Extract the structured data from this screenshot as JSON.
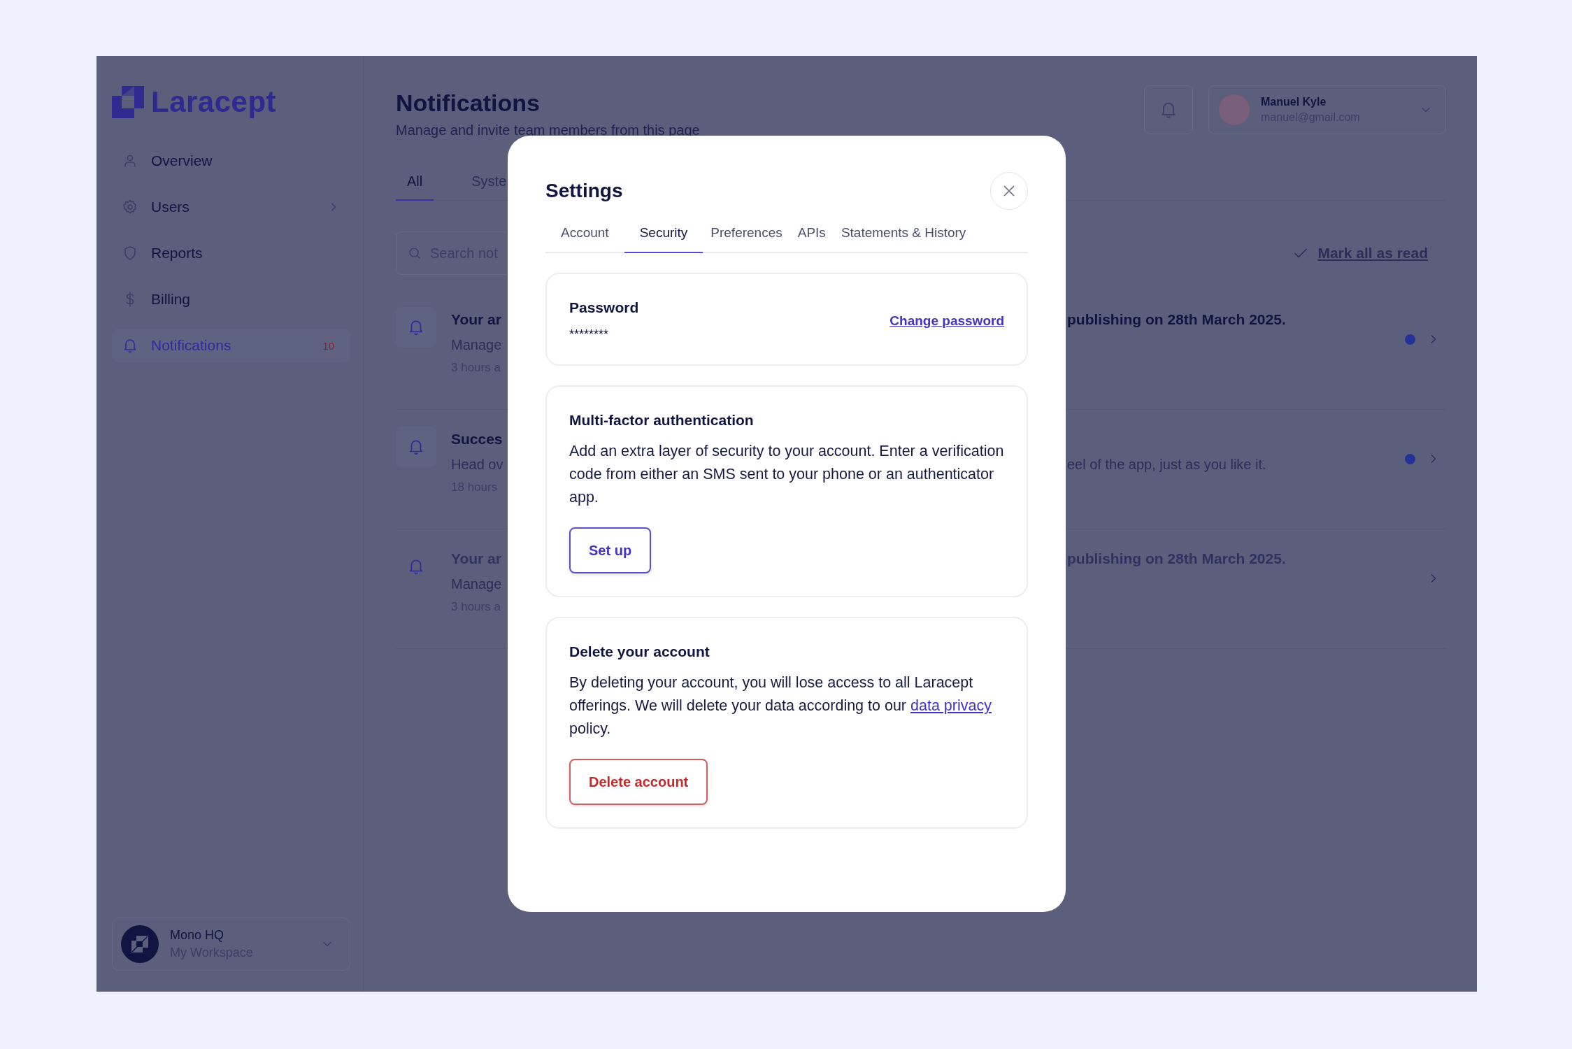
{
  "sidebar": {
    "logo": "Laracept",
    "items": [
      {
        "label": "Overview",
        "expandable": false,
        "selected": false
      },
      {
        "label": "Users",
        "expandable": true,
        "selected": false
      },
      {
        "label": "Reports",
        "expandable": false,
        "selected": false
      },
      {
        "label": "Billing",
        "expandable": false,
        "selected": false
      },
      {
        "label": "Notifications",
        "expandable": false,
        "selected": true,
        "badge": "10"
      }
    ],
    "workspace": {
      "name": "Mono HQ",
      "subtitle": "My Workspace"
    }
  },
  "header": {
    "title": "Notifications",
    "subtitle": "Manage and invite team members from this page",
    "user": {
      "name": "Manuel Kyle",
      "email": "manuel@gmail.com"
    }
  },
  "tabs": [
    {
      "label": "All",
      "selected": true
    },
    {
      "label": "Syste",
      "selected": false
    }
  ],
  "search": {
    "placeholder": "Search not"
  },
  "mark_all": "Mark all as read",
  "notifications": [
    {
      "title": "Your ar",
      "message": "Manage",
      "time": "3 hours a",
      "title_rest": "publishing on 28th March 2025.",
      "unread": true
    },
    {
      "title": "Succes",
      "message": "Head ov",
      "time": "18 hours",
      "message_rest": "eel of the app, just as you like it.",
      "unread": true
    },
    {
      "title": "Your ar",
      "message": "Manage",
      "time": "3 hours a",
      "title_rest": "publishing on 28th March 2025.",
      "unread": false
    }
  ],
  "modal": {
    "title": "Settings",
    "tabs": [
      {
        "label": "Account",
        "selected": false
      },
      {
        "label": "Security",
        "selected": true
      },
      {
        "label": "Preferences",
        "selected": false
      },
      {
        "label": "APIs",
        "selected": false
      },
      {
        "label": "Statements & History",
        "selected": false
      }
    ],
    "password": {
      "heading": "Password",
      "value": "********",
      "link": "Change password"
    },
    "mfa": {
      "heading": "Multi-factor authentication",
      "body": "Add an extra layer of security to your account. Enter a verification code from either an SMS sent to your phone or an authenticator app.",
      "button": "Set up"
    },
    "delete": {
      "heading": "Delete your account",
      "body": "By deleting your account, you will lose access to all Laracept offerings. We will delete your data according to our ",
      "link": "data privacy",
      "body_after": " policy.",
      "button": "Delete account"
    }
  }
}
